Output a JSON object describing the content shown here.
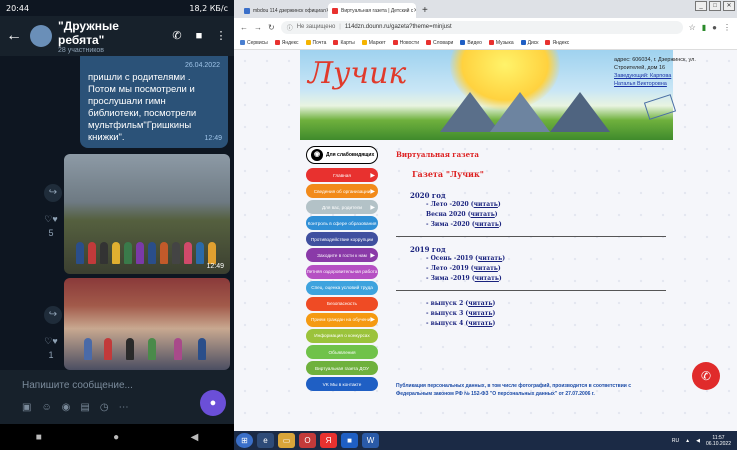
{
  "colors": {
    "telegram_bg": "#0e1621",
    "bubble": "#2b5278",
    "accent_red": "#e02b2b",
    "menu_colors": [
      "#e8312f",
      "#f28a1a",
      "#b3c2c7",
      "#2f8fd6",
      "#3f4f9f",
      "#8a3aa8",
      "#b54fc3",
      "#3ea3de",
      "#ef4b24",
      "#f59a12",
      "#9bc33b",
      "#70c24a",
      "#6fb13d",
      "#1f5fc4"
    ]
  },
  "phone": {
    "status": {
      "time": "20:44",
      "right": "18,2 КБ/с"
    },
    "chat_title": "\"Дружные ребята\"",
    "chat_subtitle": "28 участников",
    "message_text": "пришли с родителями . Потом мы посмотрели и прослушали гимн библиотеки, посмотрели мультфильм\"Гришкины книжки\".",
    "message_date": "26.04.2022",
    "message_time": "12:49",
    "photo1_time": "12:49",
    "reactions1": "5",
    "reactions2": "1",
    "input_placeholder": "Напишите сообщение...",
    "icons": [
      "back-icon",
      "phone-icon",
      "video-icon",
      "more-icon",
      "share-icon",
      "heart-icon",
      "sticker-icon",
      "emoji-icon",
      "camera-icon",
      "gif-icon",
      "timer-icon",
      "mic-icon"
    ]
  },
  "browser": {
    "tabs": [
      {
        "label": "mbdou 114 дзержинск официал"
      },
      {
        "label": "Виртуальная газета | Детский с"
      }
    ],
    "url_warning": "Не защищено",
    "url": "114dzn.dounn.ru/gazeta?theme=minjust",
    "bookmarks": [
      "Сервисы",
      "Яндекс",
      "Почта",
      "Карты",
      "Маркет",
      "Новости",
      "Словари",
      "Видео",
      "Музыка",
      "Диск",
      "Яндекс"
    ]
  },
  "site": {
    "logo": "Лучик",
    "contact": {
      "address": "адрес: 606034, г. Дзержинск, ул. Строителей, дом 16",
      "head_label": "Заведующий: Карпова",
      "head_name": "Наталья Викторовна"
    },
    "accessibility": "Для слабовидящих",
    "menu": [
      "Главная",
      "Сведения об организации",
      "Для вас, родители",
      "Контроль в сфере образования",
      "Противодействие коррупции",
      "Заходите в гости к нам",
      "Летняя оздоровительная работа",
      "Спец. оценка условий труда",
      "Безопасность",
      "Прием граждан на обучение",
      "Информация о конкурсах",
      "Объявления",
      "Виртуальная газета ДОУ",
      "VK Мы в контакте"
    ],
    "page_title": "Виртуальная газета",
    "gazeta_title": "Газета \"Лучик\"",
    "years": [
      {
        "year": "2020 год",
        "issues": [
          {
            "name": "- Лето -2020 (",
            "link": "читать",
            "tail": ")"
          },
          {
            "name": "Весна  2020 (",
            "link": "читать",
            "tail": ")"
          },
          {
            "name": "- Зима -2020 (",
            "link": "читать",
            "tail": ")"
          }
        ]
      },
      {
        "year": "2019 год",
        "issues": [
          {
            "name": "- Осень -2019 (",
            "link": "читать",
            "tail": ")"
          },
          {
            "name": "- Лето -2019 (",
            "link": "читать",
            "tail": ")"
          },
          {
            "name": "- Зима -2019 (",
            "link": "читать",
            "tail": ")"
          }
        ]
      }
    ],
    "extra_issues": [
      {
        "name": "- выпуск 2 (",
        "link": "читать",
        "tail": ")"
      },
      {
        "name": "- выпуск 3 (",
        "link": "читать",
        "tail": ")"
      },
      {
        "name": "- выпуск 4 (",
        "link": "читать",
        "tail": ")"
      }
    ],
    "footer_note": "Публикация персональных данных, в том числе фотографий, производится в соответствии с Федеральным законом РФ № 152-ФЗ \"О персональных данных\" от 27.07.2006 г."
  },
  "taskbar": {
    "apps": [
      "windows-icon",
      "ie-icon",
      "explorer-icon",
      "opera-icon",
      "yandex-icon",
      "media-icon",
      "word-icon"
    ],
    "tray_lang": "RU",
    "clock_time": "11:57",
    "clock_date": "06.10.2022"
  }
}
